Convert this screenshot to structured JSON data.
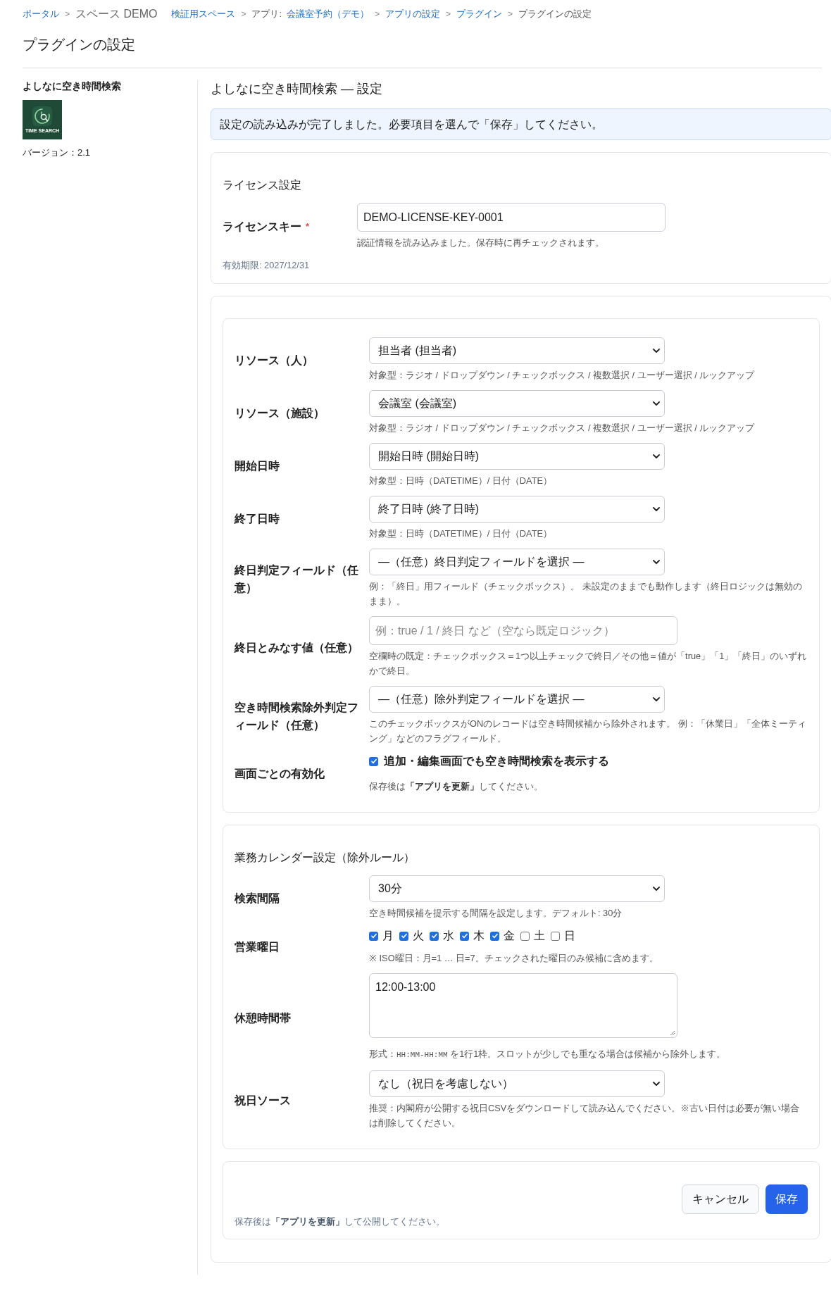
{
  "breadcrumb": [
    {
      "kind": "link",
      "text": "ポータル"
    },
    {
      "kind": "sep",
      "text": ">"
    },
    {
      "kind": "space",
      "text": "スペース DEMO"
    },
    {
      "kind": "link",
      "text": "検証用スペース"
    },
    {
      "kind": "sep",
      "text": ">"
    },
    {
      "kind": "text",
      "text": "アプリ:"
    },
    {
      "kind": "link",
      "text": "会議室予約（デモ）"
    },
    {
      "kind": "sep",
      "text": ">"
    },
    {
      "kind": "link",
      "text": "アプリの設定"
    },
    {
      "kind": "sep",
      "text": ">"
    },
    {
      "kind": "link",
      "text": "プラグイン"
    },
    {
      "kind": "sep",
      "text": ">"
    },
    {
      "kind": "text",
      "text": "プラグインの設定"
    }
  ],
  "page_title": "プラグインの設定",
  "sidebar": {
    "plugin_name": "よしなに空き時間検索",
    "logo": {
      "caption": "TIME SEARCH"
    },
    "version": "バージョン：2.1"
  },
  "main": {
    "title": "よしなに空き時間検索 — 設定",
    "notice": "設定の読み込みが完了しました。必要項目を選んで「保存」してください。",
    "license": {
      "heading": "ライセンス設定",
      "rows": [
        {
          "kind": "input",
          "label": "ライセンスキー",
          "required_mark": "*",
          "value": "DEMO-LICENSE-KEY-0001",
          "help": "認証情報を読み込みました。保存時に再チェックされます。"
        }
      ],
      "expiry": "有効期限: 2027/12/31"
    },
    "field_settings": {
      "rows": [
        {
          "kind": "select",
          "label": "リソース（人）",
          "value": "担当者 (担当者)",
          "help": "対象型：ラジオ / ドロップダウン / チェックボックス / 複数選択 / ユーザー選択 / ルックアップ"
        },
        {
          "kind": "select",
          "label": "リソース（施設）",
          "value": "会議室 (会議室)",
          "help": "対象型：ラジオ / ドロップダウン / チェックボックス / 複数選択 / ユーザー選択 / ルックアップ"
        },
        {
          "kind": "select",
          "label": "開始日時",
          "value": "開始日時 (開始日時)",
          "help": "対象型：日時（DATETIME）/ 日付（DATE）"
        },
        {
          "kind": "select",
          "label": "終了日時",
          "value": "終了日時 (終了日時)",
          "help": "対象型：日時（DATETIME）/ 日付（DATE）"
        },
        {
          "kind": "select",
          "label": "終日判定フィールド（任意）",
          "value": "—（任意）終日判定フィールドを選択 —",
          "help": "例：「終日」用フィールド（チェックボックス）。 未設定のままでも動作します（終日ロジックは無効のまま）。"
        },
        {
          "kind": "input",
          "label": "終日とみなす値（任意）",
          "placeholder": "例：true / 1 / 終日 など（空なら既定ロジック）",
          "help": "空欄時の既定：チェックボックス＝1つ以上チェックで終日／その他＝値が「true」「1」「終日」のいずれかで終日。"
        },
        {
          "kind": "select",
          "label": "空き時間検索除外判定フィールド（任意）",
          "value": "—（任意）除外判定フィールドを選択 —",
          "help": "このチェックボックスがONのレコードは空き時間候補から除外されます。 例：「休業日」「全体ミーティング」などのフラグフィールド。"
        },
        {
          "kind": "checkbox",
          "label": "画面ごとの有効化",
          "option": "追加・編集画面でも空き時間検索を表示する",
          "checked": true,
          "help": "保存後は**「アプリを更新」**してください。"
        }
      ]
    },
    "calendar": {
      "heading": "業務カレンダー設定（除外ルール）",
      "rows": [
        {
          "kind": "select",
          "label": "検索間隔",
          "value": "30分",
          "help": "空き時間候補を提示する間隔を設定します。デフォルト: 30分"
        },
        {
          "kind": "weekdays",
          "label": "営業曜日",
          "days": [
            {
              "label": "月",
              "checked": true
            },
            {
              "label": "火",
              "checked": true
            },
            {
              "label": "水",
              "checked": true
            },
            {
              "label": "木",
              "checked": true
            },
            {
              "label": "金",
              "checked": true
            },
            {
              "label": "土",
              "checked": false
            },
            {
              "label": "日",
              "checked": false
            }
          ],
          "help": "※ ISO曜日：月=1 … 日=7。チェックされた曜日のみ候補に含めます。"
        },
        {
          "kind": "textarea",
          "label": "休憩時間帯",
          "value": "12:00-13:00",
          "help": [
            {
              "kind": "text",
              "text": "形式："
            },
            {
              "kind": "code",
              "text": "HH:MM-HH:MM"
            },
            {
              "kind": "text",
              "text": " を1行1枠。スロットが少しでも重なる場合は候補から除外します。"
            }
          ]
        },
        {
          "kind": "select",
          "label": "祝日ソース",
          "value": "なし（祝日を考慮しない）",
          "help": "推奨：内閣府が公開する祝日CSVをダウンロードして読み込んでください。※古い日付は必要が無い場合は削除してください。"
        }
      ]
    },
    "footer": {
      "buttons": [
        {
          "kind": "secondary",
          "label": "キャンセル"
        },
        {
          "kind": "primary",
          "label": "保存"
        }
      ],
      "note": "保存後は**「アプリを更新」**して公開してください。"
    }
  }
}
